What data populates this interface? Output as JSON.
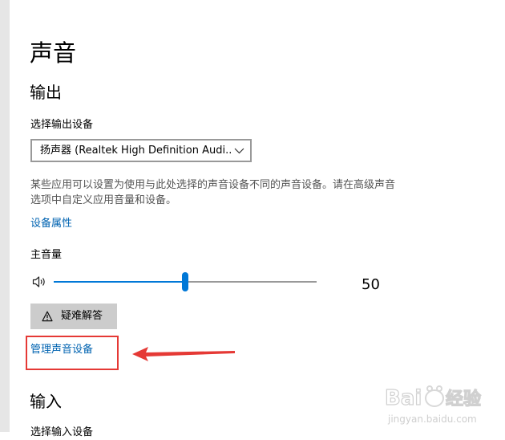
{
  "page": {
    "title": "声音"
  },
  "output": {
    "section_title": "输出",
    "choose_device_label": "选择输出设备",
    "device_selected": "扬声器 (Realtek High Definition Audi...",
    "description": "某些应用可以设置为使用与此处选择的声音设备不同的声音设备。请在高级声音选项中自定义应用音量和设备。",
    "device_properties_link": "设备属性",
    "master_volume_label": "主音量",
    "volume": 50,
    "volume_text": "50",
    "troubleshoot_label": "疑难解答",
    "manage_devices_link": "管理声音设备"
  },
  "input": {
    "section_title": "输入",
    "choose_device_label_partial": "选择输入设备"
  },
  "annotation": {
    "highlight_color": "#e53935"
  },
  "watermark": {
    "brand": "Baidu经验",
    "url": "jingyan.baidu.com"
  },
  "colors": {
    "accent": "#0078d7",
    "link": "#0063b1"
  },
  "icons": {
    "volume": "speaker-icon",
    "dropdown": "chevron-down-icon",
    "troubleshoot": "warning-icon"
  }
}
